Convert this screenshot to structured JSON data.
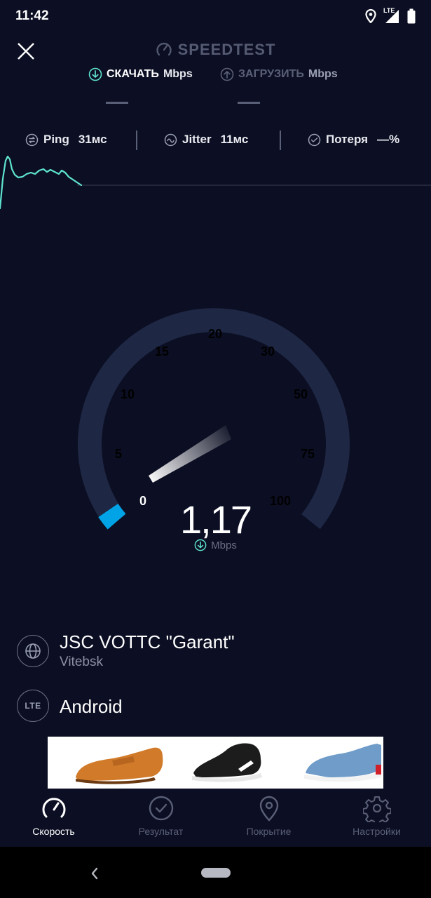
{
  "status_bar": {
    "time": "11:42",
    "network": "LTE"
  },
  "header": {
    "title": "SPEEDTEST",
    "download_label": "СКАЧАТЬ",
    "upload_label": "ЗАГРУЗИТЬ",
    "download_unit": "Mbps",
    "upload_unit": "Mbps",
    "download_value": "—",
    "upload_value": "—"
  },
  "metrics": {
    "ping_label": "Ping",
    "ping_value": "31мс",
    "jitter_label": "Jitter",
    "jitter_value": "11мс",
    "loss_label": "Потеря",
    "loss_value": "—%"
  },
  "gauge": {
    "ticks": [
      "0",
      "5",
      "10",
      "15",
      "20",
      "30",
      "50",
      "75",
      "100"
    ],
    "reading": "1,17",
    "unit": "Mbps",
    "accent": "#00a3e6"
  },
  "provider": {
    "name": "JSC VOTTC \"Garant\"",
    "city": "Vitebsk"
  },
  "device": {
    "badge": "LTE",
    "name": "Android"
  },
  "nav": {
    "items": [
      {
        "label": "Скорость",
        "icon": "speedometer-icon",
        "active": true
      },
      {
        "label": "Результат",
        "icon": "check-circle-icon"
      },
      {
        "label": "Покрытие",
        "icon": "location-pin-icon"
      },
      {
        "label": "Настройки",
        "icon": "gear-icon"
      }
    ]
  },
  "colors": {
    "background": "#0c0f23",
    "accent": "#00a3e6",
    "graph": "#5ee3d0"
  }
}
